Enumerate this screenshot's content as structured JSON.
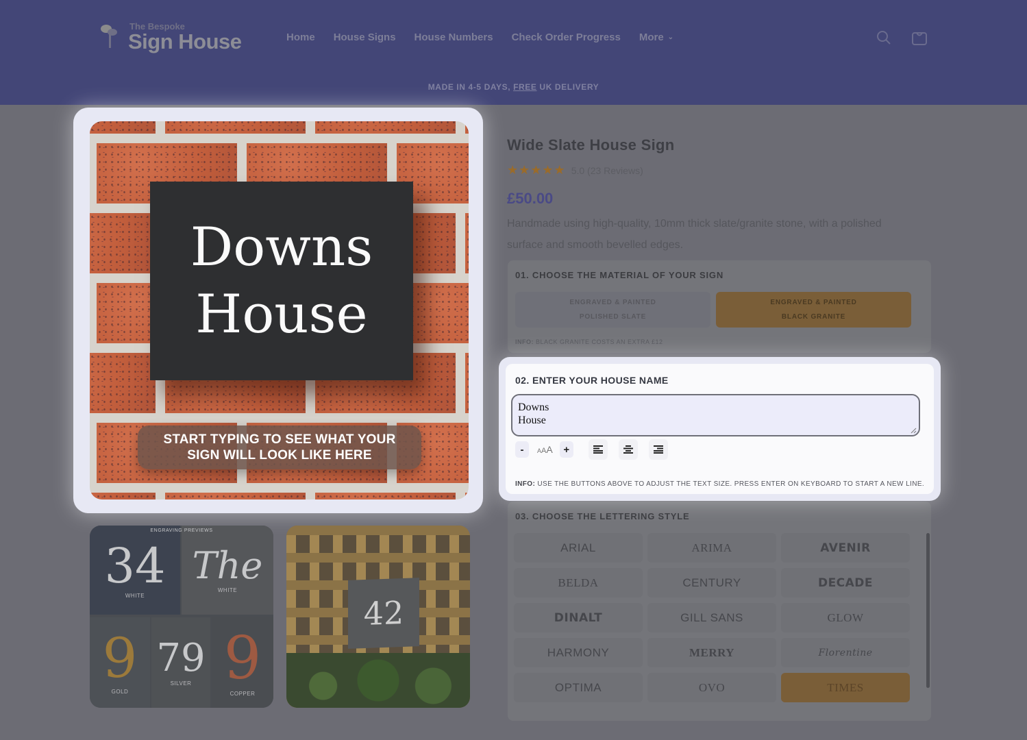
{
  "header": {
    "logo_small": "The Bespoke",
    "logo_big": "Sign House",
    "nav": [
      "Home",
      "House Signs",
      "House Numbers",
      "Check Order Progress",
      "More"
    ],
    "icons": [
      "search-icon",
      "cart-icon"
    ],
    "banner_prefix": "MADE IN 4-5 DAYS, ",
    "banner_free": "FREE",
    "banner_suffix": " UK DELIVERY"
  },
  "preview": {
    "sign_lines": [
      "Downs",
      "House"
    ],
    "overlay_line1": "START TYPING TO SEE WHAT YOUR",
    "overlay_line2": "SIGN WILL LOOK LIKE HERE"
  },
  "thumbnails": {
    "thumb1": {
      "heading": "ENGRAVING PREVIEWS",
      "cells": [
        {
          "num": "34",
          "caption": "WHITE"
        },
        {
          "num": "The",
          "caption": "WHITE"
        },
        {
          "num": "9",
          "caption": "GOLD"
        },
        {
          "num": "79",
          "caption": "SILVER"
        },
        {
          "num": "9",
          "caption": "COPPER"
        }
      ]
    },
    "thumb2": {
      "num": "42"
    }
  },
  "product": {
    "title": "Wide Slate House Sign",
    "stars": "★★★★★",
    "rating_text": "5.0 (23 Reviews)",
    "price": "£50.00",
    "description": "Handmade using high-quality, 10mm thick slate/granite stone, with a polished surface and smooth bevelled edges."
  },
  "material": {
    "label": "01. CHOOSE THE MATERIAL OF YOUR SIGN",
    "options": [
      {
        "line1": "ENGRAVED & PAINTED",
        "line2": "POLISHED SLATE",
        "selected": false
      },
      {
        "line1": "ENGRAVED & PAINTED",
        "line2": "BLACK GRANITE",
        "selected": true
      }
    ],
    "info_label": "INFO:",
    "info_text": " BLACK GRANITE COSTS AN EXTRA £12"
  },
  "house_name": {
    "label": "02. ENTER YOUR HOUSE NAME",
    "value": "Downs\nHouse",
    "minus": "-",
    "plus": "+",
    "size_glyphs": [
      "A",
      "A",
      "A"
    ],
    "align_options": [
      "align-left",
      "align-center",
      "align-right"
    ],
    "info_label": "INFO:",
    "info_text": " USE THE BUTTONS ABOVE TO ADJUST THE TEXT SIZE. PRESS ENTER ON KEYBOARD TO START A NEW LINE."
  },
  "lettering": {
    "label": "03. CHOOSE THE LETTERING STYLE",
    "fonts": [
      "ARIAL",
      "ARIMA",
      "AVENIR",
      "BELDA",
      "CENTURY",
      "DECADE",
      "DINALT",
      "GILL SANS",
      "GLOW",
      "HARMONY",
      "MERRY",
      "Florentine",
      "OPTIMA",
      "OVO",
      "TIMES"
    ],
    "selected": "TIMES"
  },
  "colors": {
    "header_bg": "#434677",
    "accent_selected": "#7a5e38",
    "price": "#4a4a86"
  }
}
